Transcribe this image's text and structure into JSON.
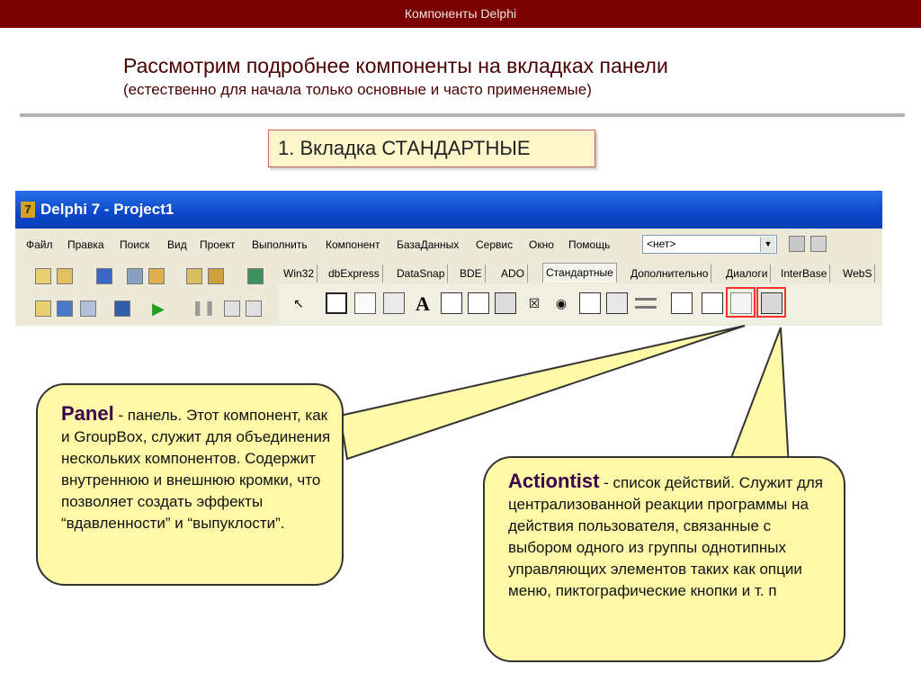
{
  "header": {
    "title": "Компоненты Delphi"
  },
  "slide": {
    "title": "Рассмотрим подробнее компоненты на вкладках панели",
    "subtitle": "(естественно для начала только основные и часто применяемые)",
    "section": "1. Вкладка СТАНДАРТНЫЕ"
  },
  "ide": {
    "window_title": "Delphi 7 - Project1",
    "logo_text": "7",
    "menu": [
      "Файл",
      "Правка",
      "Поиск",
      "Вид",
      "Проект",
      "Выполнить",
      "Компонент",
      "БазаДанных",
      "Сервис",
      "Окно",
      "Помощь"
    ],
    "combo_value": "<нет>",
    "tabs": [
      "Win32",
      "dbExpress",
      "DataSnap",
      "BDE",
      "ADO",
      "Стандартные",
      "Дополнительно",
      "Диалоги",
      "InterBase",
      "WebS"
    ],
    "active_tab": "Стандартные",
    "palette_glyphs": {
      "label": "A",
      "radio": "◉",
      "checkbox": "☒"
    }
  },
  "callouts": {
    "panel": {
      "name": "Panel",
      "text": " - панель. Этот компонент, как и GroupBox, служит для объединения нескольких компонентов. Содержит внутреннюю и внешнюю кромки, что позволяет создать эффекты “вдавленности” и “выпуклости”."
    },
    "actionlist": {
      "name": "Actiontist",
      "text": " - список действий. Служит для централизованной реакции программы на действия пользователя, связанные с выбором одного из группы однотипных управляющих элементов таких как опции меню, пиктографические кнопки и т. п"
    }
  },
  "colors": {
    "header_bg": "#7a0000",
    "bubble_bg": "#fff9a8",
    "highlight": "#ff3030",
    "titlebar": "#0a46c9"
  }
}
